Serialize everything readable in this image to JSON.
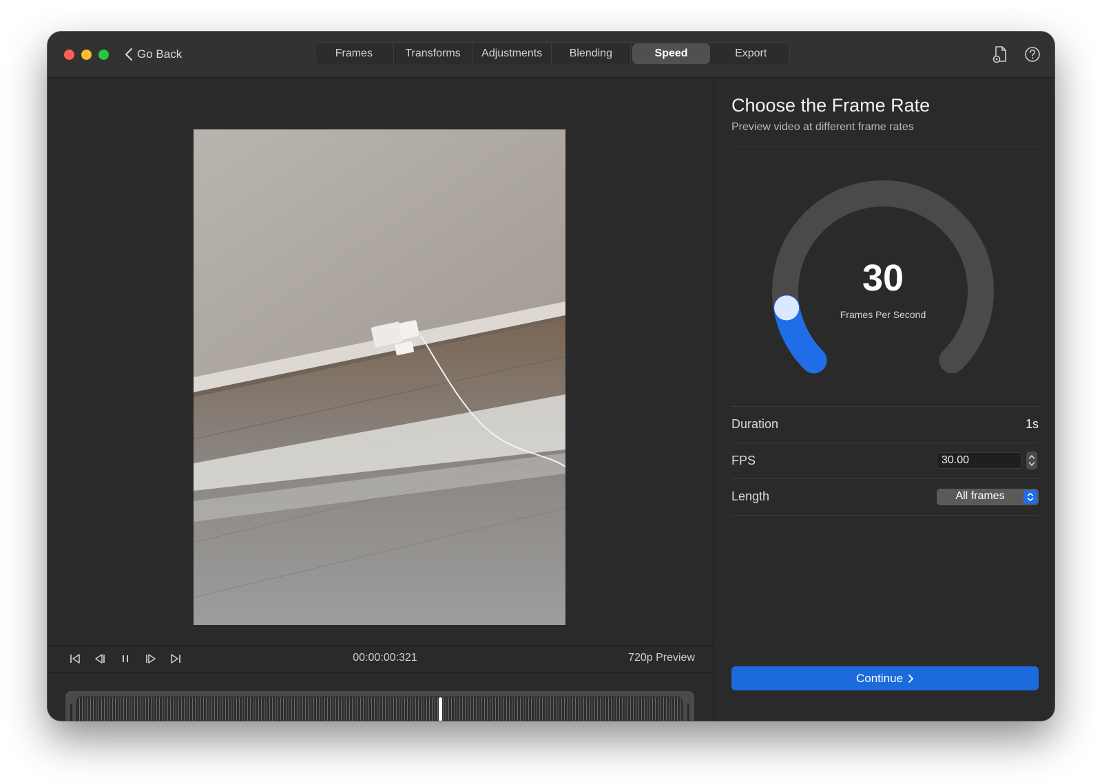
{
  "titlebar": {
    "back_label": "Go Back",
    "tabs": [
      {
        "label": "Frames",
        "active": false
      },
      {
        "label": "Transforms",
        "active": false
      },
      {
        "label": "Adjustments",
        "active": false
      },
      {
        "label": "Blending",
        "active": false
      },
      {
        "label": "Speed",
        "active": true
      },
      {
        "label": "Export",
        "active": false
      }
    ],
    "icons": [
      "document-settings-icon",
      "help-icon"
    ]
  },
  "player": {
    "timecode": "00:00:00:321",
    "preview_label": "720p Preview",
    "controls": [
      "skip-to-start-icon",
      "step-back-icon",
      "pause-icon",
      "step-forward-icon",
      "skip-to-end-icon"
    ],
    "playhead_fraction": 0.6
  },
  "speed_panel": {
    "title": "Choose the Frame Rate",
    "subtitle": "Preview video at different frame rates",
    "gauge": {
      "value": "30",
      "unit_label": "Frames Per Second",
      "fill_fraction": 0.13
    },
    "duration": {
      "label": "Duration",
      "value": "1s"
    },
    "fps": {
      "label": "FPS",
      "value": "30.00"
    },
    "length": {
      "label": "Length",
      "selected": "All frames"
    },
    "continue_label": "Continue"
  },
  "colors": {
    "accent": "#1c6bdc",
    "gauge_fill": "#1f6ee8",
    "gauge_track": "#4a4a4a",
    "knob": "#dbe8ff",
    "window_bg": "#2a2a2a",
    "traffic_close": "#ff5f57",
    "traffic_minimize": "#febc2e",
    "traffic_maximize": "#28c840"
  }
}
